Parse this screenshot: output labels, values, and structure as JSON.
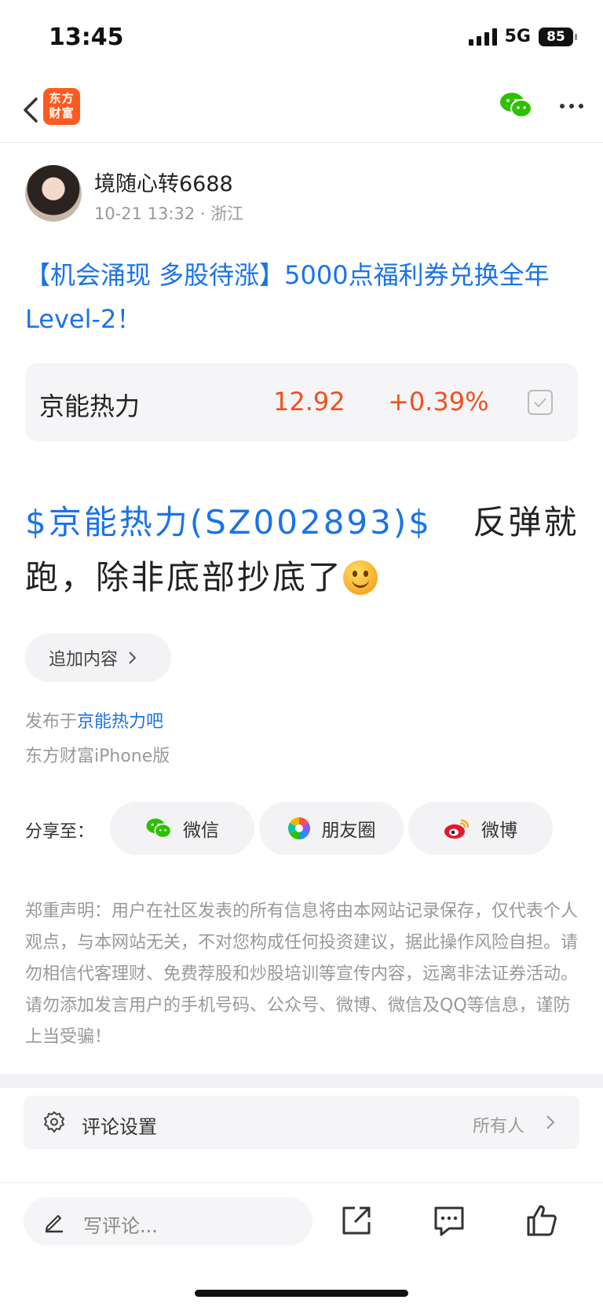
{
  "status_bar": {
    "time": "13:45",
    "network": "5G",
    "battery": "85"
  },
  "nav": {
    "logo_text_line1": "东方",
    "logo_text_line2": "财富"
  },
  "author": {
    "name": "境随心转6688",
    "meta": "10-21 13:32 · 浙江"
  },
  "post": {
    "title": "【机会涌现 多股待涨】5000点福利券兑换全年Level-2！",
    "stock_link": "$京能热力(SZ002893)$",
    "body_text": "反弹就跑，除非底部抄底了"
  },
  "stock_card": {
    "name": "京能热力",
    "price": "12.92",
    "change": "+0.39%",
    "color_up": "#f0501e"
  },
  "append_button": {
    "label": "追加内容"
  },
  "published": {
    "prefix": "发布于",
    "forum": "京能热力吧",
    "client": "东方财富iPhone版"
  },
  "share": {
    "label": "分享至：",
    "targets": [
      {
        "label": "微信",
        "icon": "wechat-icon"
      },
      {
        "label": "朋友圈",
        "icon": "moments-icon"
      },
      {
        "label": "微博",
        "icon": "weibo-icon"
      }
    ]
  },
  "disclaimer": "郑重声明：用户在社区发表的所有信息将由本网站记录保存，仅代表个人观点，与本网站无关，不对您构成任何投资建议，据此操作风险自担。请勿相信代客理财、免费荐股和炒股培训等宣传内容，远离非法证券活动。请勿添加发言用户的手机号码、公众号、微博、微信及QQ等信息，谨防上当受骗！",
  "comment_setting": {
    "label": "评论设置",
    "value": "所有人"
  },
  "bottom_bar": {
    "placeholder": "写评论..."
  },
  "colors": {
    "link": "#1a73e8",
    "brand": "#ff5a1f",
    "wechat": "#2dc100"
  }
}
